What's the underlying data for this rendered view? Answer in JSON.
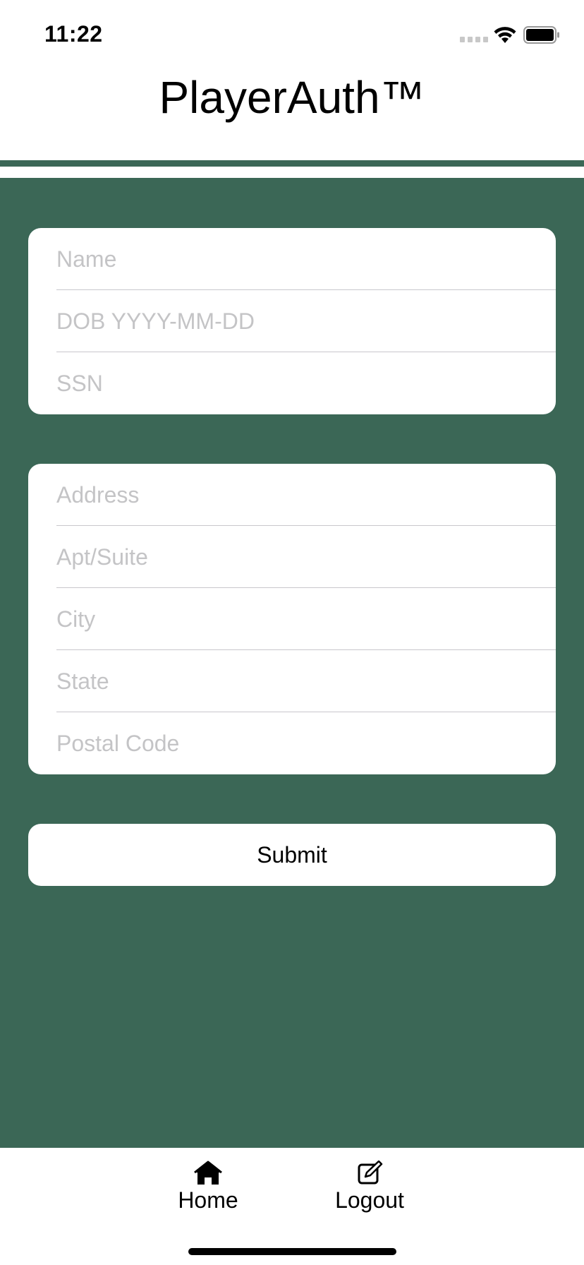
{
  "status_bar": {
    "time": "11:22",
    "icons": [
      "signal-icon",
      "wifi-icon",
      "battery-icon"
    ]
  },
  "header": {
    "title": "PlayerAuth™"
  },
  "colors": {
    "accent_green": "#3b6756",
    "card_background": "#ffffff",
    "placeholder": "#c4c4c6"
  },
  "personal_form": {
    "name_placeholder": "Name",
    "dob_placeholder": "DOB YYYY-MM-DD",
    "ssn_placeholder": "SSN"
  },
  "address_form": {
    "address_placeholder": "Address",
    "apt_placeholder": "Apt/Suite",
    "city_placeholder": "City",
    "state_placeholder": "State",
    "postal_placeholder": "Postal Code"
  },
  "actions": {
    "submit_label": "Submit"
  },
  "tab_bar": {
    "home_label": "Home",
    "home_icon": "house-icon",
    "logout_label": "Logout",
    "logout_icon": "compose-icon"
  }
}
